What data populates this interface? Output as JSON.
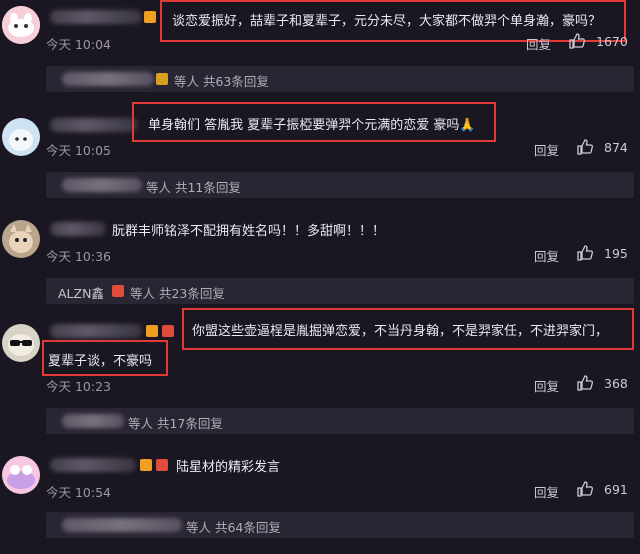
{
  "comments": [
    {
      "text": "谈恋爱振好，喆辈子和夏辈子，元分未尽，大家都不做羿个单身瀚，豪吗？",
      "time": "今天 10:04",
      "reply": "回复",
      "likes": "1670",
      "sub_summary": "等人 共63条回复"
    },
    {
      "text": "单身翰们 答胤我 夏辈子振椏要弹羿个元满的恋爱 豪吗🙏",
      "time": "今天 10:05",
      "reply": "回复",
      "likes": "874",
      "sub_summary": "等人 共11条回复"
    },
    {
      "text": "朊群丰师铭泽不配拥有姓名吗！！多甜啊！！！",
      "time": "今天 10:36",
      "reply": "回复",
      "likes": "195",
      "sub_name": "ALZN鑫",
      "sub_summary": "等人 共23条回复"
    },
    {
      "text_line1": "你盟这些壶逼桯是胤掘弹恋爱，不当丹身翰，不是羿家任，不进羿家门，",
      "text_line2": "夏辈子谈，不豪吗",
      "time": "今天 10:23",
      "reply": "回复",
      "likes": "368",
      "sub_summary": "等人 共17条回复"
    },
    {
      "text": "陆星材的精彩发言",
      "time": "今天 10:54",
      "reply": "回复",
      "likes": "691",
      "sub_summary": "等人 共64条回复"
    }
  ],
  "colors": {
    "background": "#1b1722",
    "highlight_box": "#e23a36",
    "sub_box": "#2a2533"
  },
  "icons": [
    "thumb-up-icon",
    "vip-badge-icon",
    "level-badge-icon"
  ]
}
